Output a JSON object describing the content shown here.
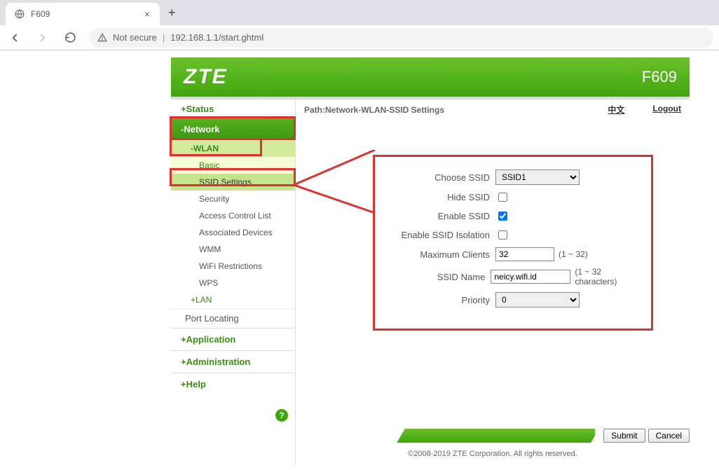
{
  "browser": {
    "tab_title": "F609",
    "not_secure": "Not secure",
    "url": "192.168.1.1/start.ghtml"
  },
  "header": {
    "logo": "ZTE",
    "model": "F609"
  },
  "path": {
    "label": "Path:Network-WLAN-SSID Settings",
    "lang": "中文",
    "logout": "Logout"
  },
  "nav": {
    "status": "+Status",
    "network": "-Network",
    "wlan": "-WLAN",
    "basic": "Basic",
    "ssid_settings": "SSID Settings",
    "security": "Security",
    "acl": "Access Control List",
    "assoc": "Associated Devices",
    "wmm": "WMM",
    "wifi_restrict": "WiFi Restrictions",
    "wps": "WPS",
    "lan": "+LAN",
    "port_locating": "Port Locating",
    "application": "+Application",
    "administration": "+Administration",
    "help": "+Help"
  },
  "form": {
    "choose_ssid_label": "Choose SSID",
    "choose_ssid_value": "SSID1",
    "hide_ssid_label": "Hide SSID",
    "hide_ssid_checked": false,
    "enable_ssid_label": "Enable SSID",
    "enable_ssid_checked": true,
    "isolation_label": "Enable SSID Isolation",
    "isolation_checked": false,
    "max_clients_label": "Maximum Clients",
    "max_clients_value": "32",
    "max_clients_hint": "(1 ~ 32)",
    "ssid_name_label": "SSID Name",
    "ssid_name_value": "neicy.wifi.id",
    "ssid_name_hint": "(1 ~ 32 characters)",
    "priority_label": "Priority",
    "priority_value": "0"
  },
  "footer": {
    "submit": "Submit",
    "cancel": "Cancel",
    "copyright": "©2008-2019 ZTE Corporation. All rights reserved."
  }
}
